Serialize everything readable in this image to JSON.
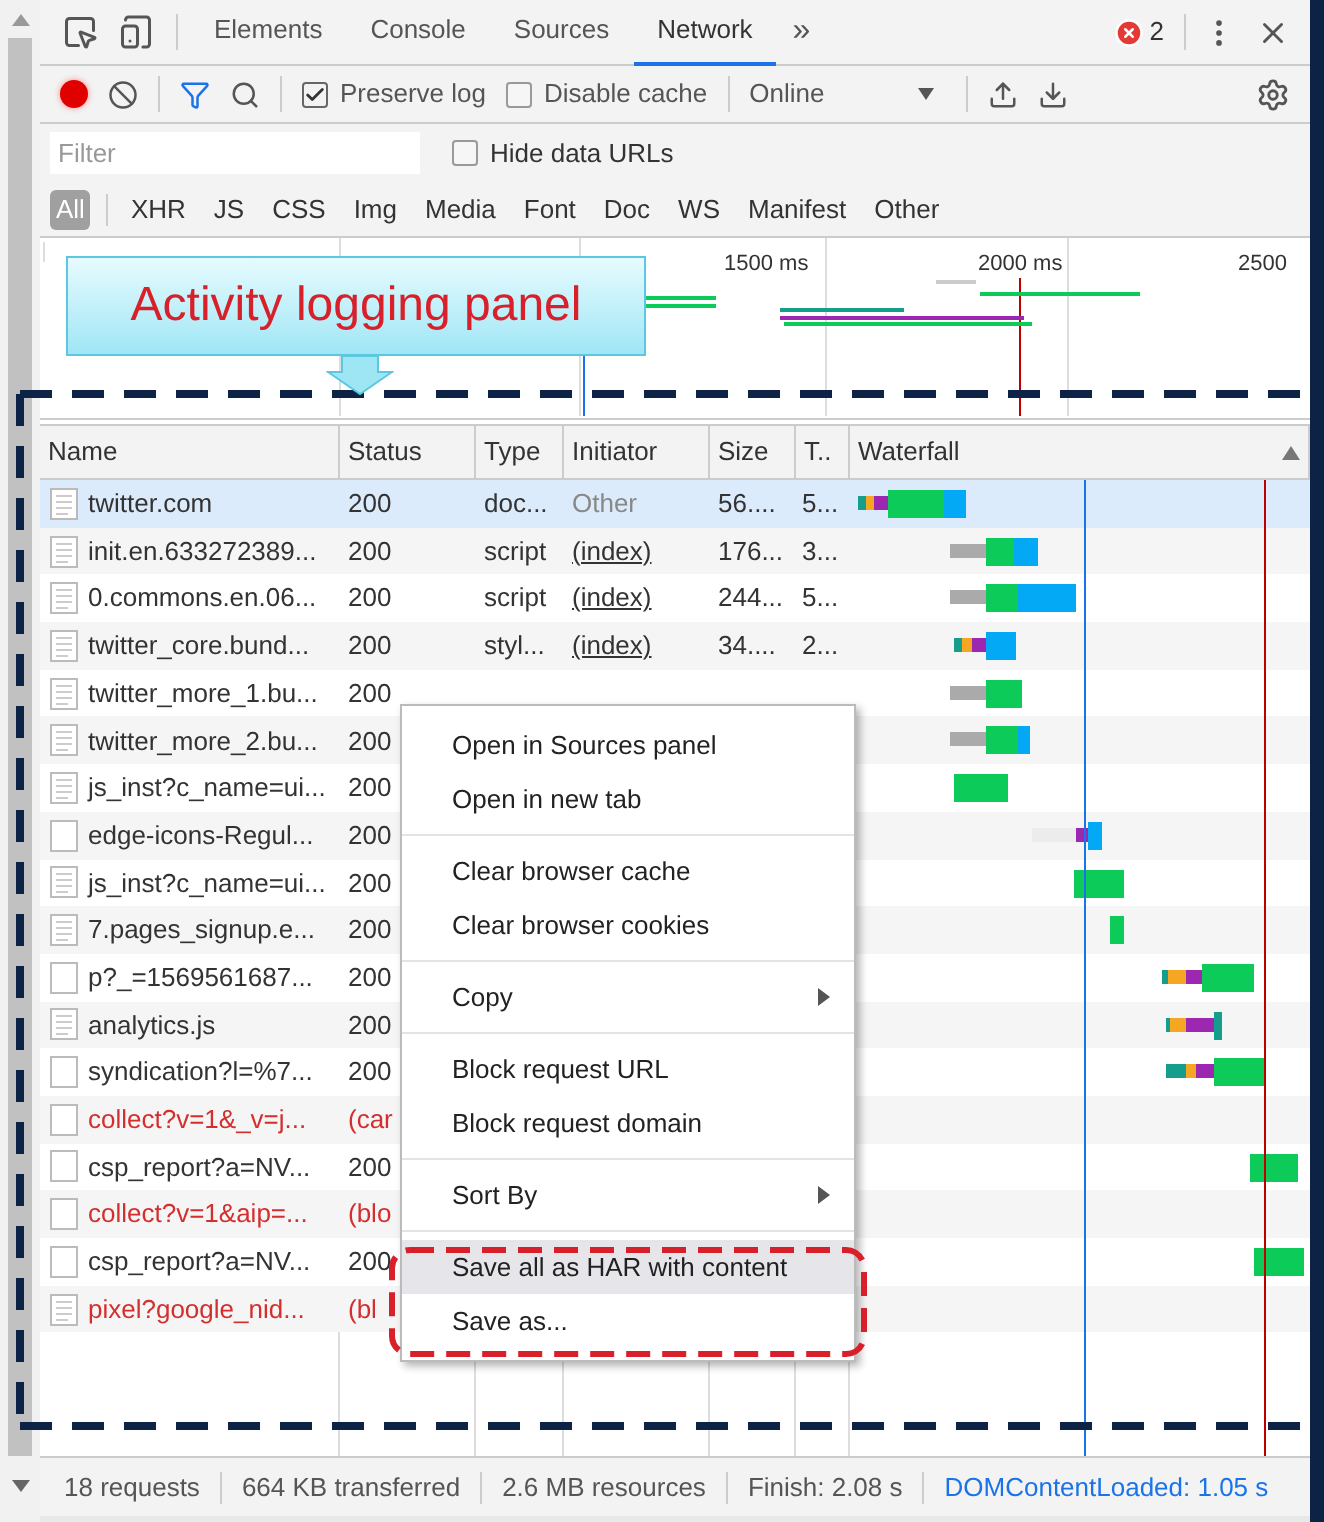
{
  "devtools_tabs": [
    {
      "label": "Elements",
      "selected": false
    },
    {
      "label": "Console",
      "selected": false
    },
    {
      "label": "Sources",
      "selected": false
    },
    {
      "label": "Network",
      "selected": true
    }
  ],
  "more_tabs": "»",
  "error_count": "2",
  "toolbar": {
    "recording": true,
    "preserve_log": {
      "label": "Preserve log",
      "checked": true
    },
    "disable_cache": {
      "label": "Disable cache",
      "checked": false
    },
    "throttling": "Online"
  },
  "filter": {
    "placeholder": "Filter"
  },
  "hide_data_urls": {
    "label": "Hide data URLs",
    "checked": false
  },
  "type_filters": [
    {
      "label": "All",
      "selected": true
    },
    {
      "label": "XHR",
      "selected": false
    },
    {
      "label": "JS",
      "selected": false
    },
    {
      "label": "CSS",
      "selected": false
    },
    {
      "label": "Img",
      "selected": false
    },
    {
      "label": "Media",
      "selected": false
    },
    {
      "label": "Font",
      "selected": false
    },
    {
      "label": "Doc",
      "selected": false
    },
    {
      "label": "WS",
      "selected": false
    },
    {
      "label": "Manifest",
      "selected": false
    },
    {
      "label": "Other",
      "selected": false
    }
  ],
  "overview_ticks": [
    "1500 ms",
    "2000 ms",
    "2500"
  ],
  "callout": "Activity logging panel",
  "table": {
    "columns": [
      "Name",
      "Status",
      "Type",
      "Initiator",
      "Size",
      "T..",
      "Waterfall"
    ],
    "rows": [
      {
        "name": "twitter.com",
        "status": "200",
        "type": "doc...",
        "initiator": "Other",
        "initiator_link": false,
        "size": "56....",
        "time": "5...",
        "kind": "text",
        "error": false,
        "selected": true
      },
      {
        "name": "init.en.633272389...",
        "status": "200",
        "type": "script",
        "initiator": "(index)",
        "initiator_link": true,
        "size": "176...",
        "time": "3...",
        "kind": "text",
        "error": false,
        "selected": false
      },
      {
        "name": "0.commons.en.06...",
        "status": "200",
        "type": "script",
        "initiator": "(index)",
        "initiator_link": true,
        "size": "244...",
        "time": "5...",
        "kind": "text",
        "error": false,
        "selected": false
      },
      {
        "name": "twitter_core.bund...",
        "status": "200",
        "type": "styl...",
        "initiator": "(index)",
        "initiator_link": true,
        "size": "34....",
        "time": "2...",
        "kind": "text",
        "error": false,
        "selected": false
      },
      {
        "name": "twitter_more_1.bu...",
        "status": "200",
        "kind": "text",
        "error": false,
        "selected": false
      },
      {
        "name": "twitter_more_2.bu...",
        "status": "200",
        "kind": "text",
        "error": false,
        "selected": false
      },
      {
        "name": "js_inst?c_name=ui...",
        "status": "200",
        "kind": "text",
        "error": false,
        "selected": false
      },
      {
        "name": "edge-icons-Regul...",
        "status": "200",
        "kind": "blank",
        "error": false,
        "selected": false
      },
      {
        "name": "js_inst?c_name=ui...",
        "status": "200",
        "kind": "text",
        "error": false,
        "selected": false
      },
      {
        "name": "7.pages_signup.e...",
        "status": "200",
        "kind": "text",
        "error": false,
        "selected": false
      },
      {
        "name": "p?_=1569561687...",
        "status": "200",
        "kind": "blank",
        "error": false,
        "selected": false
      },
      {
        "name": "analytics.js",
        "status": "200",
        "kind": "text",
        "error": false,
        "selected": false
      },
      {
        "name": "syndication?l=%7...",
        "status": "200",
        "kind": "blank",
        "error": false,
        "selected": false
      },
      {
        "name": "collect?v=1&_v=j...",
        "status": "(car",
        "kind": "blank",
        "error": true,
        "selected": false
      },
      {
        "name": "csp_report?a=NV...",
        "status": "200",
        "kind": "blank",
        "error": false,
        "selected": false
      },
      {
        "name": "collect?v=1&aip=...",
        "status": "(blo",
        "kind": "blank",
        "error": true,
        "selected": false
      },
      {
        "name": "csp_report?a=NV...",
        "status": "200",
        "kind": "blank",
        "error": false,
        "selected": false
      },
      {
        "name": "pixel?google_nid...",
        "status": "(bl",
        "kind": "text",
        "error": true,
        "selected": false
      }
    ]
  },
  "context_menu": {
    "groups": [
      [
        {
          "label": "Open in Sources panel",
          "submenu": false,
          "highlighted": false
        },
        {
          "label": "Open in new tab",
          "submenu": false,
          "highlighted": false
        }
      ],
      [
        {
          "label": "Clear browser cache",
          "submenu": false,
          "highlighted": false
        },
        {
          "label": "Clear browser cookies",
          "submenu": false,
          "highlighted": false
        }
      ],
      [
        {
          "label": "Copy",
          "submenu": true,
          "highlighted": false
        }
      ],
      [
        {
          "label": "Block request URL",
          "submenu": false,
          "highlighted": false
        },
        {
          "label": "Block request domain",
          "submenu": false,
          "highlighted": false
        }
      ],
      [
        {
          "label": "Sort By",
          "submenu": true,
          "highlighted": false
        }
      ],
      [
        {
          "label": "Save all as HAR with content",
          "submenu": false,
          "highlighted": true
        },
        {
          "label": "Save as...",
          "submenu": false,
          "highlighted": false
        }
      ]
    ]
  },
  "status_bar": [
    {
      "text": "18 requests",
      "kind": "stat"
    },
    {
      "text": "664 KB transferred",
      "kind": "stat"
    },
    {
      "text": "2.6 MB resources",
      "kind": "stat"
    },
    {
      "text": "Finish: 2.08 s",
      "kind": "stat"
    },
    {
      "text": "DOMContentLoaded: 1.05 s",
      "kind": "event"
    }
  ]
}
